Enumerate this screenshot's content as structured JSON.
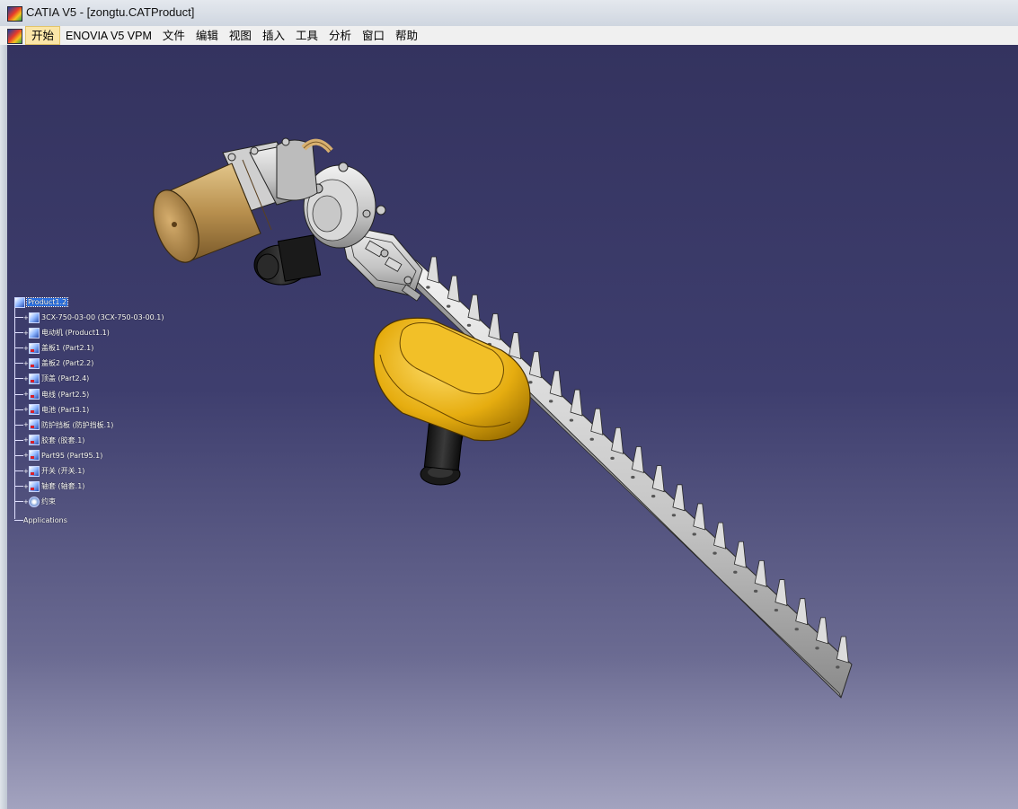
{
  "window": {
    "title": "CATIA V5 - [zongtu.CATProduct]"
  },
  "menu": {
    "items": [
      {
        "label": "开始",
        "active": true
      },
      {
        "label": "ENOVIA V5 VPM"
      },
      {
        "label": "文件"
      },
      {
        "label": "编辑"
      },
      {
        "label": "视图"
      },
      {
        "label": "插入"
      },
      {
        "label": "工具"
      },
      {
        "label": "分析"
      },
      {
        "label": "窗口"
      },
      {
        "label": "帮助"
      }
    ]
  },
  "spec_tree": {
    "root": "Product1.2",
    "nodes": [
      {
        "label": "3CX-750-03-00 (3CX-750-03-00.1)",
        "icon": "product-icon"
      },
      {
        "label": "电动机 (Product1.1)",
        "icon": "product-icon"
      },
      {
        "label": "盖板1 (Part2.1)",
        "icon": "part-icon"
      },
      {
        "label": "盖板2 (Part2.2)",
        "icon": "part-icon"
      },
      {
        "label": "顶盖 (Part2.4)",
        "icon": "part-icon"
      },
      {
        "label": "电线 (Part2.5)",
        "icon": "part-icon"
      },
      {
        "label": "电池 (Part3.1)",
        "icon": "part-icon"
      },
      {
        "label": "防护挡板 (防护挡板.1)",
        "icon": "part-icon"
      },
      {
        "label": "胶套 (胶套.1)",
        "icon": "part-icon"
      },
      {
        "label": "Part95 (Part95.1)",
        "icon": "part-icon"
      },
      {
        "label": "开关 (开关.1)",
        "icon": "part-icon"
      },
      {
        "label": "轴套 (轴套.1)",
        "icon": "part-icon"
      },
      {
        "label": "约束",
        "icon": "constraints-icon"
      }
    ],
    "applications": "Applications"
  },
  "colors": {
    "viewport_top": "#34335f",
    "viewport_bottom": "#a3a3bf",
    "handle_yellow": "#e8b010",
    "motor_tan": "#c8a060",
    "blade_gray": "#c8c8c8",
    "selection_blue": "#2a6fe0"
  }
}
